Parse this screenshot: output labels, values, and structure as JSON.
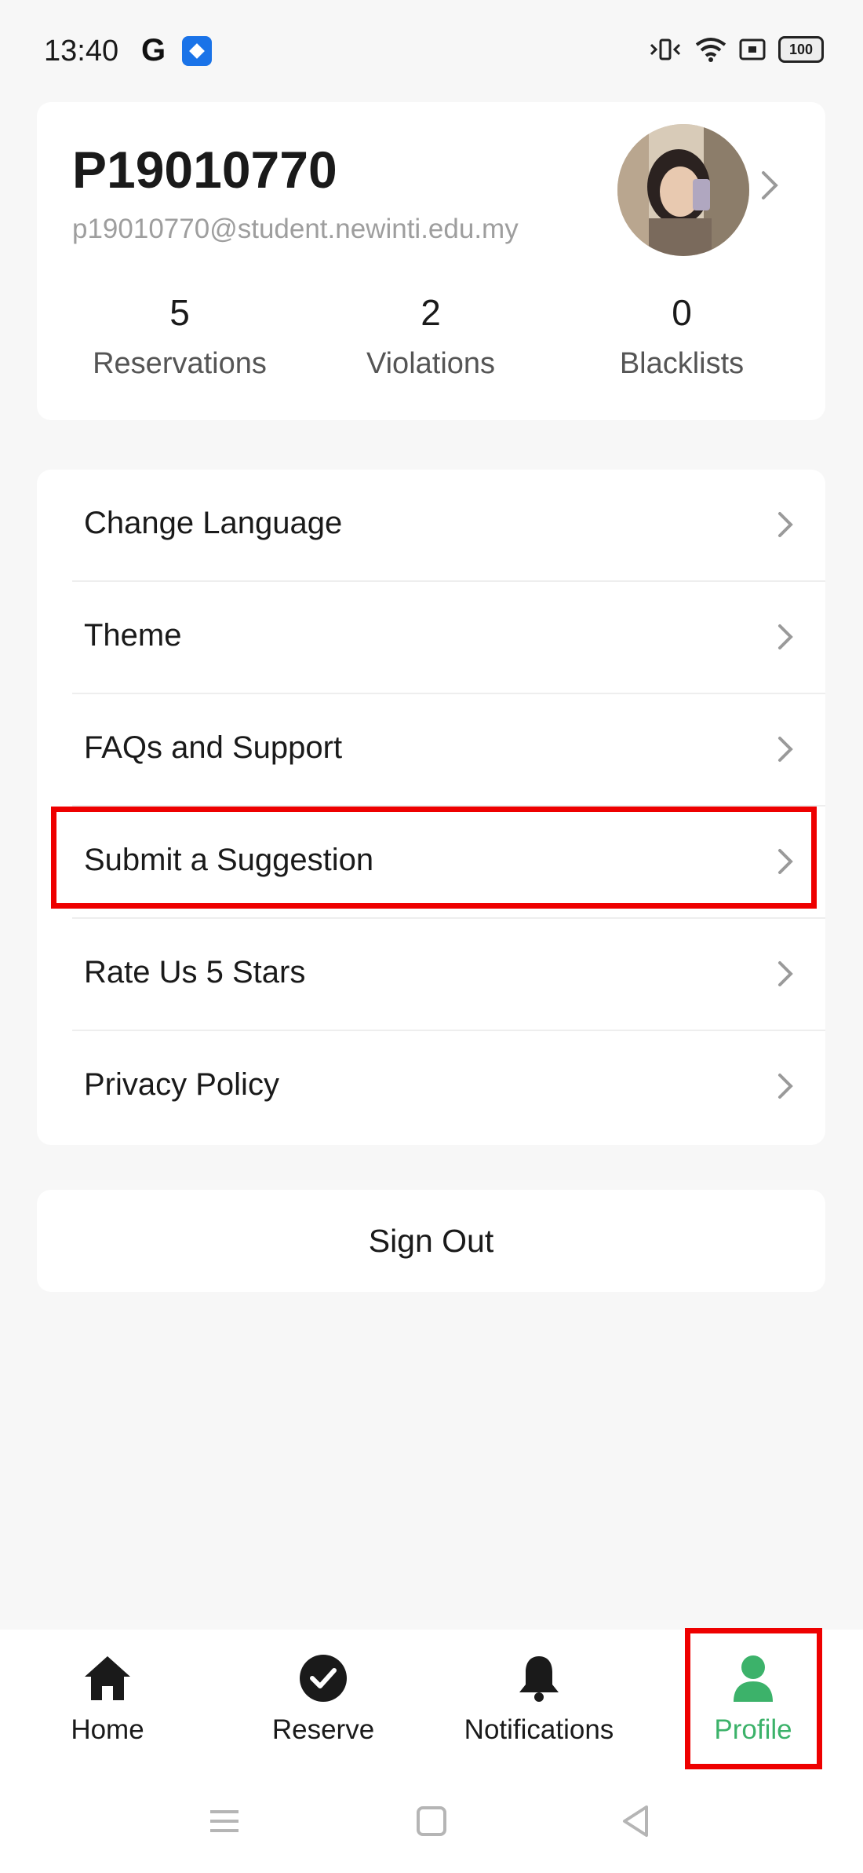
{
  "status_bar": {
    "time": "13:40",
    "battery": "100",
    "icons": [
      "google-icon",
      "app-badge-icon",
      "vibrate-icon",
      "wifi-icon",
      "screen-record-icon",
      "battery-icon"
    ]
  },
  "profile": {
    "name": "P19010770",
    "email": "p19010770@student.newinti.edu.my",
    "stats": [
      {
        "value": "5",
        "label": "Reservations"
      },
      {
        "value": "2",
        "label": "Violations"
      },
      {
        "value": "0",
        "label": "Blacklists"
      }
    ]
  },
  "menu": {
    "items": [
      {
        "label": "Change Language"
      },
      {
        "label": "Theme"
      },
      {
        "label": "FAQs and Support"
      },
      {
        "label": "Submit a Suggestion"
      },
      {
        "label": "Rate Us 5 Stars"
      },
      {
        "label": "Privacy Policy"
      }
    ]
  },
  "sign_out": {
    "label": "Sign Out"
  },
  "bottom_nav": {
    "items": [
      {
        "label": "Home",
        "icon": "home-icon"
      },
      {
        "label": "Reserve",
        "icon": "check-circle-icon"
      },
      {
        "label": "Notifications",
        "icon": "bell-icon"
      },
      {
        "label": "Profile",
        "icon": "person-icon",
        "active": true
      }
    ]
  },
  "colors": {
    "accent": "#3cb26a",
    "highlight": "#ee0000",
    "background": "#f7f7f7",
    "card": "#ffffff"
  }
}
